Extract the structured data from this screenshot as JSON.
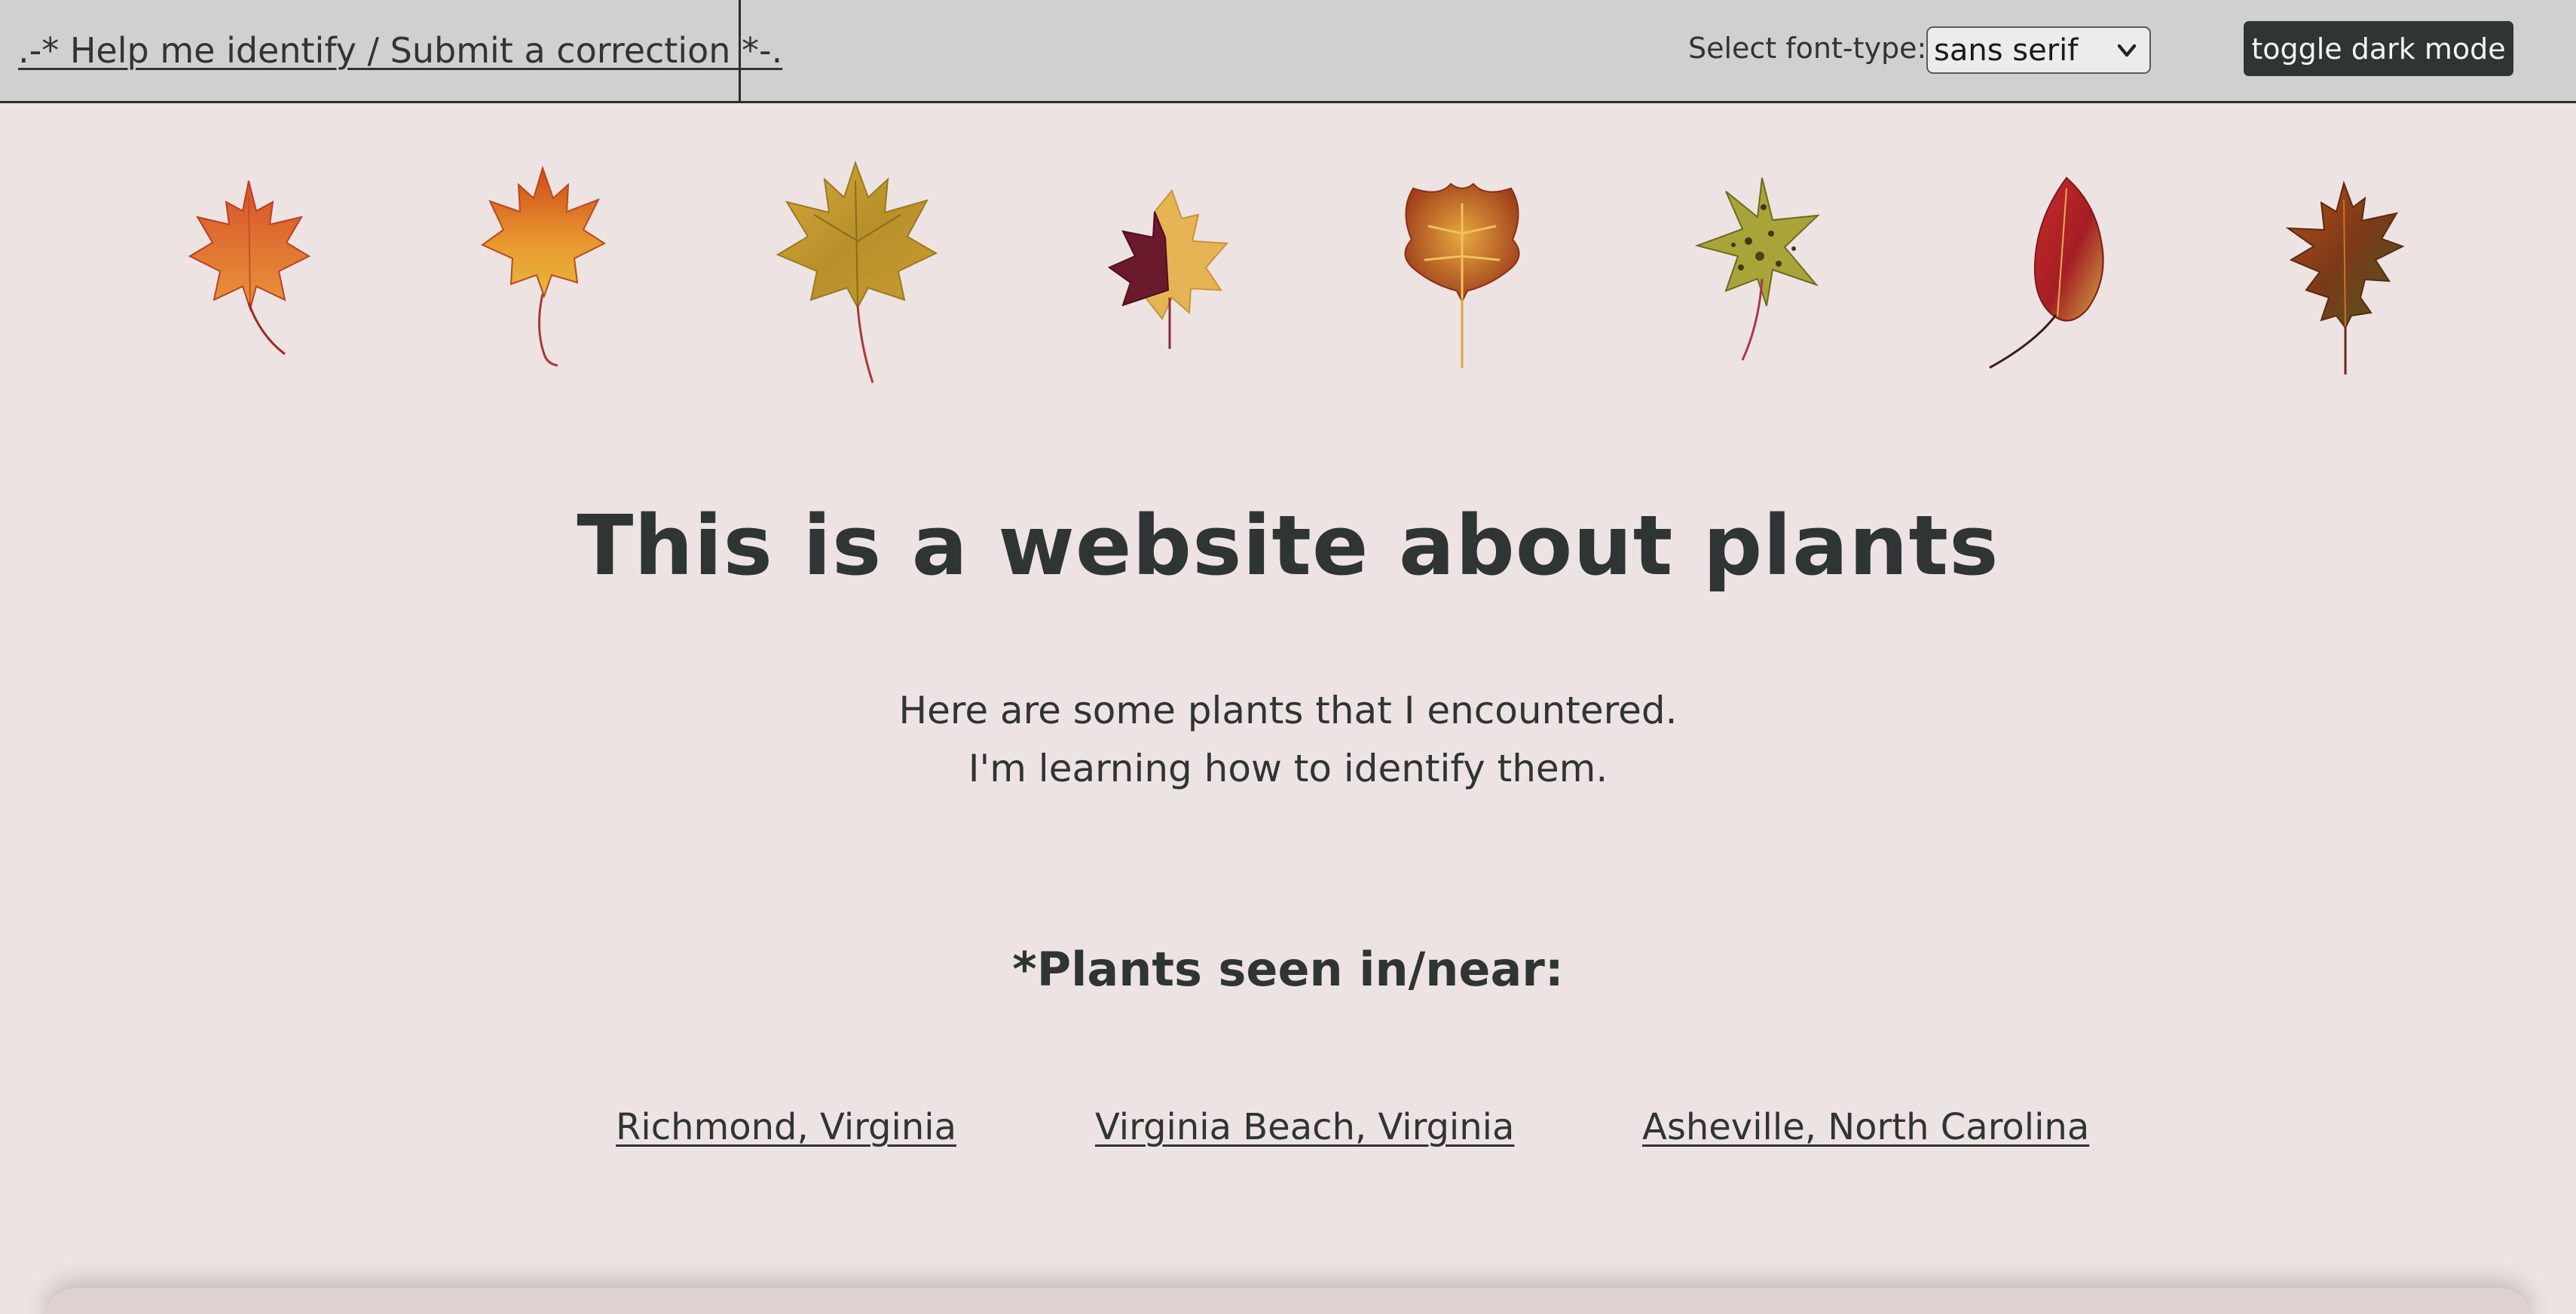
{
  "topbar": {
    "help_link": ".-* Help me identify / Submit a correction *-.",
    "font_select_label": "Select font-type:",
    "font_select_value": "sans serif",
    "dark_mode_button": "toggle dark mode"
  },
  "main": {
    "title": "This is a website about plants",
    "intro_line1": "Here are some plants that I encountered.",
    "intro_line2": "I'm learning how to identify them.",
    "seen_heading": "*Plants seen in/near:",
    "locations": [
      "Richmond, Virginia",
      "Virginia Beach, Virginia",
      "Asheville, North Carolina"
    ]
  },
  "leaves": [
    {
      "name": "red-orange-maple-leaf-icon",
      "colors": [
        "#d8502a",
        "#e8963a"
      ]
    },
    {
      "name": "orange-yellow-maple-leaf-icon",
      "colors": [
        "#d86a22",
        "#e6b23a"
      ]
    },
    {
      "name": "golden-maple-leaf-icon",
      "colors": [
        "#c9a034",
        "#9a7a2a"
      ]
    },
    {
      "name": "purple-yellow-maple-leaf-icon",
      "colors": [
        "#6e1e2e",
        "#e8b858"
      ]
    },
    {
      "name": "tulip-poplar-leaf-icon",
      "colors": [
        "#a8401a",
        "#e0a040"
      ]
    },
    {
      "name": "spotted-sweetgum-leaf-icon",
      "colors": [
        "#9a9a32",
        "#4a4a18"
      ]
    },
    {
      "name": "red-elm-leaf-icon",
      "colors": [
        "#b82a2a",
        "#c8a040"
      ]
    },
    {
      "name": "oak-leaf-icon",
      "colors": [
        "#8a3a1a",
        "#4a5a22"
      ]
    }
  ],
  "colors": {
    "background": "#ede3e2",
    "topbar": "#d0d0d0",
    "text": "#2f3434",
    "button": "#2f3434"
  }
}
